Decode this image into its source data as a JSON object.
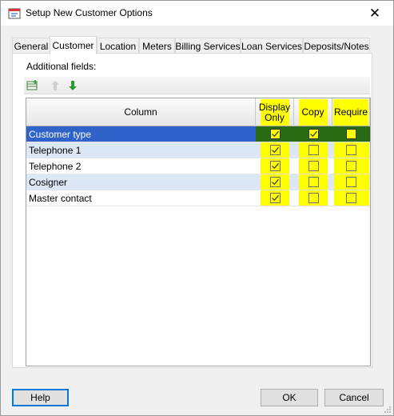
{
  "window": {
    "title": "Setup New Customer Options",
    "close_glyph": "✕",
    "icon": "settings-dialog-icon"
  },
  "tabs": [
    {
      "label": "General",
      "active": false
    },
    {
      "label": "Customer",
      "active": true
    },
    {
      "label": "Location",
      "active": false
    },
    {
      "label": "Meters",
      "active": false
    },
    {
      "label": "Billing Services",
      "active": false
    },
    {
      "label": "Loan Services",
      "active": false
    },
    {
      "label": "Deposits/Notes",
      "active": false
    }
  ],
  "panel": {
    "fields_label": "Additional fields:",
    "toolbar": {
      "add_icon": "add-field-icon",
      "up_icon": "move-up-arrow-icon",
      "down_icon": "move-down-arrow-icon"
    }
  },
  "grid": {
    "headers": {
      "column": "Column",
      "display_only": "Display Only",
      "copy": "Copy",
      "require": "Require"
    },
    "rows": [
      {
        "name": "Customer type",
        "display_only": true,
        "copy": true,
        "require": false,
        "selected": true
      },
      {
        "name": "Telephone 1",
        "display_only": true,
        "copy": false,
        "require": false,
        "selected": false
      },
      {
        "name": "Telephone 2",
        "display_only": true,
        "copy": false,
        "require": false,
        "selected": false
      },
      {
        "name": "Cosigner",
        "display_only": true,
        "copy": false,
        "require": false,
        "selected": false
      },
      {
        "name": "Master contact",
        "display_only": true,
        "copy": false,
        "require": false,
        "selected": false
      }
    ]
  },
  "buttons": {
    "help": "Help",
    "ok": "OK",
    "cancel": "Cancel"
  },
  "colors": {
    "highlight": "#ffff00",
    "selected_row": "#3063c9",
    "selected_check_cell": "#296b12",
    "alt_row": "#dde8f6",
    "focus_border": "#0078d7"
  }
}
